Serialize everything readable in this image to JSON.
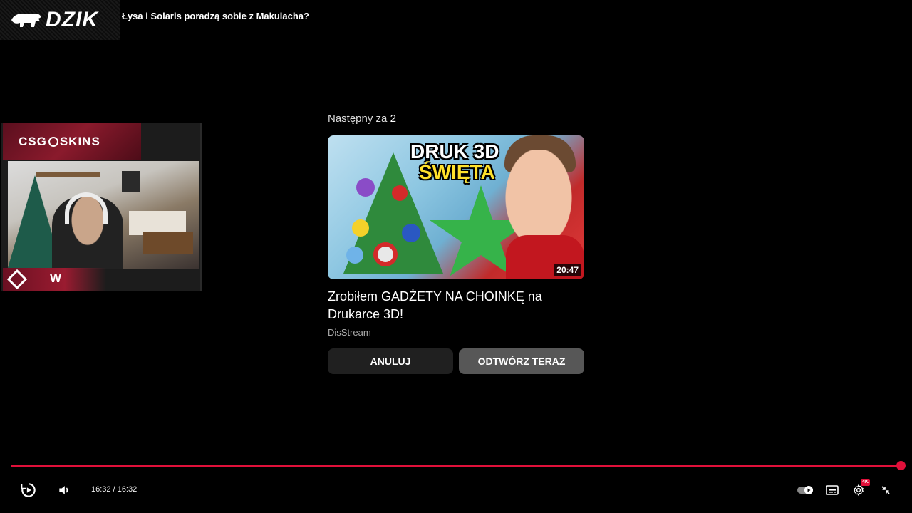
{
  "header": {
    "channel_logo_text": "DZIK",
    "video_title": "Łysa i Solaris poradzą sobie z Makulacha?"
  },
  "stream_overlay": {
    "sponsor_left": "CSG",
    "sponsor_right": "SKINS",
    "footer_badge": "W"
  },
  "up_next": {
    "label": "Następny za",
    "countdown": "2",
    "thumbnail_text_line1": "DRUK 3D",
    "thumbnail_text_line2": "ŚWIĘTA",
    "duration": "20:47",
    "title": "Zrobiłem GADŻETY NA CHOINKĘ na Drukarce 3D!",
    "channel": "DisStream",
    "cancel_label": "ANULUJ",
    "play_now_label": "ODTWÓRZ TERAZ"
  },
  "player": {
    "progress_fraction": 1.0,
    "time": "16:32 / 16:32",
    "quality_badge": "4K",
    "accent_color": "#e0103a",
    "icons": [
      "replay-icon",
      "volume-icon",
      "autoplay-toggle-icon",
      "subtitles-icon",
      "settings-icon",
      "exit-fullscreen-icon"
    ]
  }
}
